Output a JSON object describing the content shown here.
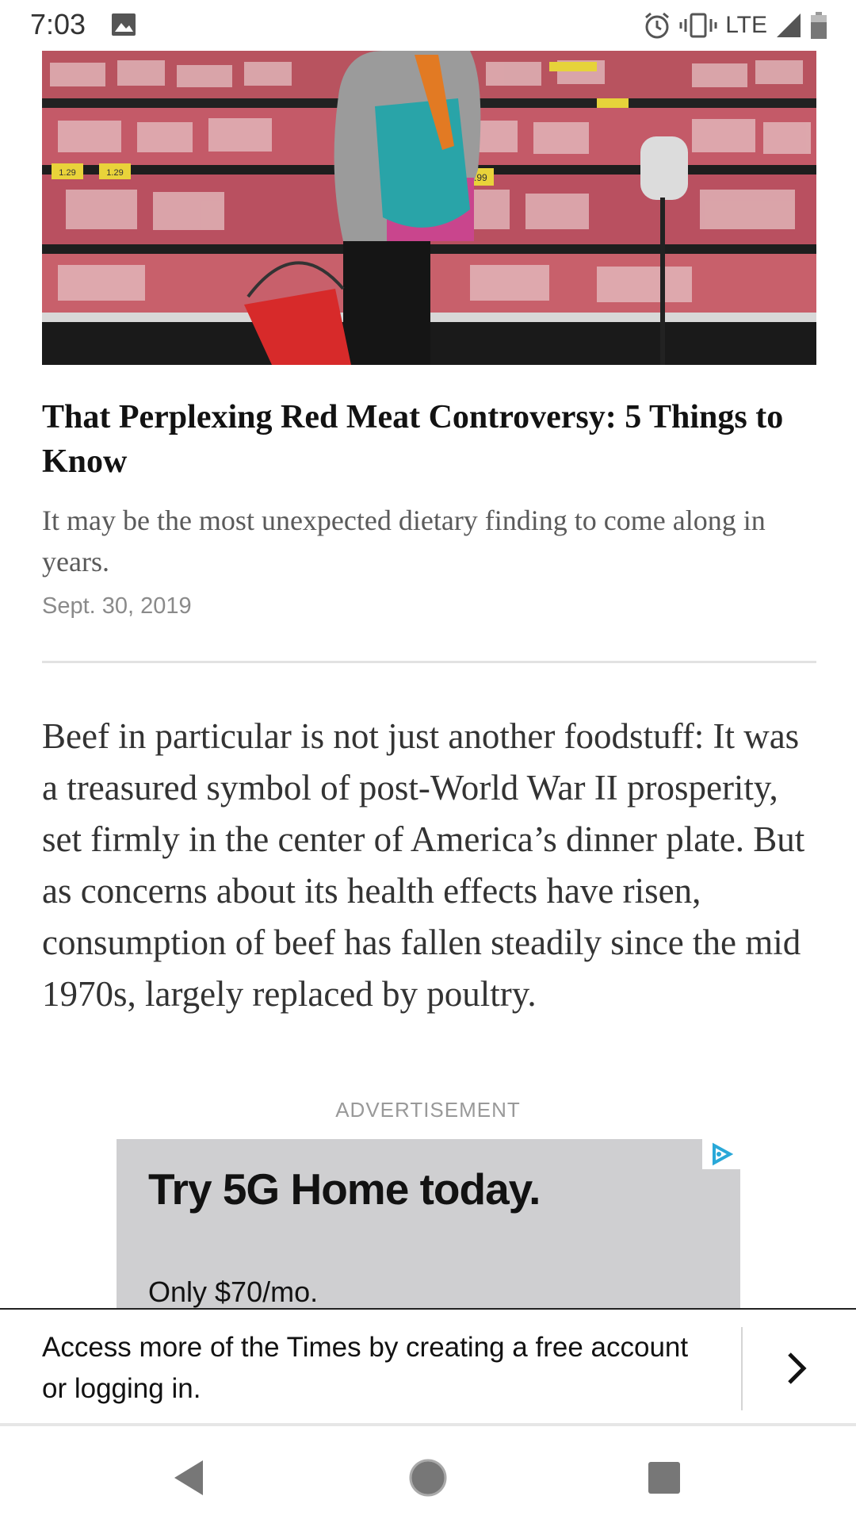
{
  "status_bar": {
    "time": "7:03",
    "network": "LTE",
    "icons": [
      "image-icon",
      "alarm-icon",
      "vibrate-icon",
      "signal-icon",
      "battery-icon"
    ]
  },
  "hero_image": {
    "description_icon": "photo",
    "price_tags": [
      "1.29",
      "1.29",
      "2.99"
    ]
  },
  "teaser": {
    "title": "That Perplexing Red Meat Controversy: 5 Things to Know",
    "summary": "It may be the most unexpected dietary finding to come along in years.",
    "date": "Sept. 30, 2019"
  },
  "article": {
    "paragraph": "Beef in particular is not just another foodstuff: It was a treasured symbol of post-World War II prosperity, set firmly in the center of America’s dinner plate. But as concerns about its health effects have risen, consumption of beef has fallen steadily since the mid 1970s, largely replaced by poultry."
  },
  "advertisement": {
    "label": "ADVERTISEMENT",
    "headline": "Try 5G Home today.",
    "price": "Only $70/mo.",
    "ad_choice_icon": "adchoices-icon"
  },
  "banner": {
    "text": "Access more of the Times by creating a free account or logging in.",
    "arrow_icon": "chevron-right-icon"
  },
  "nav_bar": {
    "buttons": [
      "back-icon",
      "home-icon",
      "recents-icon"
    ]
  },
  "colors": {
    "text_primary": "#121212",
    "text_secondary": "#5a5a5a",
    "text_meta": "#8a8a8a",
    "ad_background": "#cfcfd1",
    "ad_choice_blue": "#29a8d8"
  }
}
